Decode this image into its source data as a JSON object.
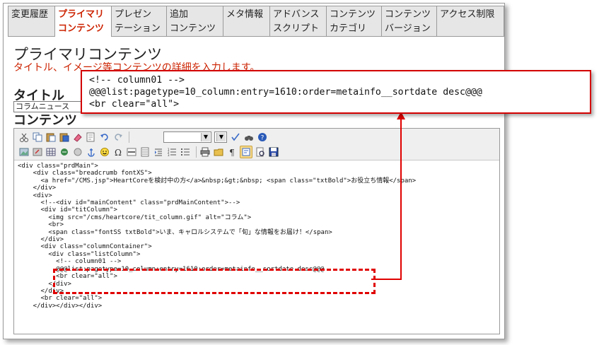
{
  "tabs": [
    {
      "label": "変更履歴",
      "active": false
    },
    {
      "label": "プライマリ\nコンテンツ",
      "active": true
    },
    {
      "label": "プレゼン\nテーション",
      "active": false
    },
    {
      "label": "追加\nコンテンツ",
      "active": false
    },
    {
      "label": "メタ情報",
      "active": false
    },
    {
      "label": "アドバンス\nスクリプト",
      "active": false
    },
    {
      "label": "コンテンツ\nカテゴリ",
      "active": false
    },
    {
      "label": "コンテンツ\nバージョン",
      "active": false
    },
    {
      "label": "アクセス制限",
      "active": false
    }
  ],
  "header": {
    "title": "プライマリコンテンツ",
    "subtitle": "タイトル、イメージ等コンテンツの詳細を入力します。"
  },
  "form": {
    "title_label": "タイトル",
    "title_value": "コラムニュース",
    "content_label": "コンテンツ"
  },
  "toolbar": {
    "row1": [
      "cut-icon",
      "copy-icon",
      "paste-icon",
      "paste-word-icon",
      "eraser-icon",
      "find-icon",
      "undo-icon",
      "redo-icon",
      "format-select",
      "style-select",
      "spellcheck-icon",
      "binoculars-icon",
      "help-icon"
    ],
    "row2": [
      "image-icon",
      "flash-icon",
      "table-icon",
      "link-icon",
      "unlink-icon",
      "anchor-icon",
      "smiley-icon",
      "special-char-icon",
      "hr-icon",
      "pagebreak-icon",
      "indent-icon",
      "ordered-list-icon",
      "unordered-list-icon",
      "print-icon",
      "template-icon",
      "paragraph-icon",
      "source-icon",
      "preview-icon",
      "save-icon"
    ]
  },
  "code": {
    "lines": [
      "<div class=\"prdMain\">",
      "    <div class=\"breadcrumb fontXS\">",
      "      <a href=\"/CMS.jsp\">HeartCoreを検討中の方</a>&nbsp;&gt;&nbsp; <span class=\"txtBold\">お役立ち情報</span>",
      "    </div>",
      "    <div>",
      "      <!--<div id=\"mainContent\" class=\"prdMainContent\">-->",
      "      <div id=\"titColumn\">",
      "        <img src=\"/cms/heartcore/tit_column.gif\" alt=\"コラム\">",
      "        <br>",
      "        <span class=\"fontSS txtBold\">いま、キャロルシステムで「旬」な情報をお届け！</span>",
      "      </div>",
      "      <div class=\"columnContainer\">",
      "        <div class=\"listColumn\">",
      "          <!-- column01 -->",
      "          @@@list:pagetype=10_column:entry=1610:order=metainfo__sortdate desc@@@",
      "          <br clear=\"all\">",
      "        </div>",
      "      </div>",
      "      <br clear=\"all\">",
      "    </div></div></div>"
    ]
  },
  "callout": {
    "lines": [
      "<!-- column01 -->",
      "@@@list:pagetype=10_column:entry=1610:order=metainfo__sortdate desc@@@",
      "<br clear=\"all\">"
    ]
  },
  "colors": {
    "accent_red": "#d40000",
    "tab_active_text": "#cc2200",
    "tab_bg": "#e6e6e6"
  }
}
